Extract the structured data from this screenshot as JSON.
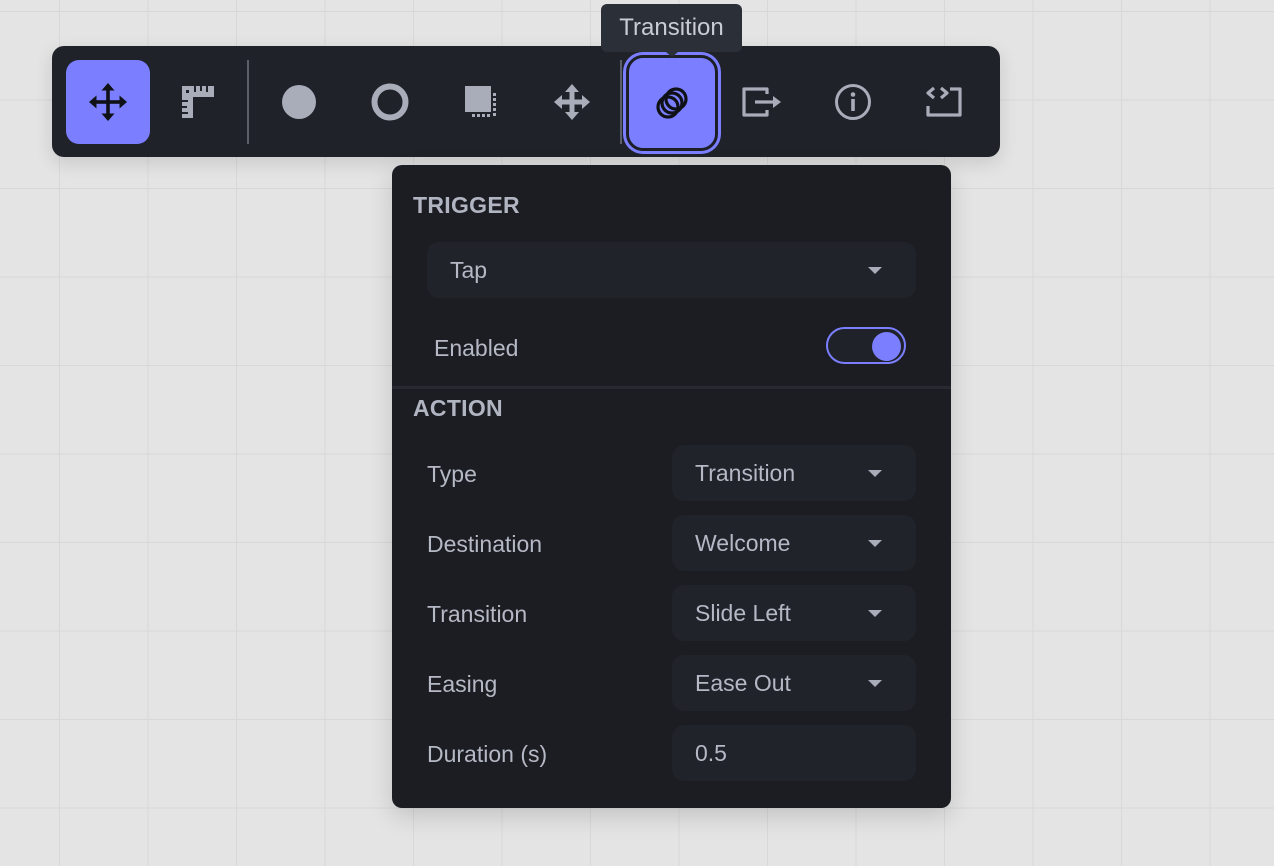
{
  "toolbar": {
    "tools": [
      {
        "id": "move",
        "icon": "move-arrows-icon",
        "state": "active"
      },
      {
        "id": "measure",
        "icon": "ruler-icon",
        "state": "default"
      },
      {
        "id": "circle-fill",
        "icon": "filled-circle-icon",
        "state": "default"
      },
      {
        "id": "circle-outline",
        "icon": "ring-icon",
        "state": "default"
      },
      {
        "id": "shadow-box",
        "icon": "square-shadow-icon",
        "state": "default"
      },
      {
        "id": "pan",
        "icon": "pan-arrows-icon",
        "state": "default"
      },
      {
        "id": "transition",
        "icon": "overlapping-rings-icon",
        "state": "selected"
      },
      {
        "id": "export",
        "icon": "exit-arrow-icon",
        "state": "default"
      },
      {
        "id": "info",
        "icon": "info-icon",
        "state": "default"
      },
      {
        "id": "embed",
        "icon": "code-box-icon",
        "state": "default"
      }
    ],
    "tooltip": "Transition"
  },
  "panel": {
    "trigger": {
      "title": "TRIGGER",
      "event": "Tap",
      "enabled_label": "Enabled",
      "enabled": true
    },
    "action": {
      "title": "ACTION",
      "rows": [
        {
          "label": "Type",
          "value": "Transition",
          "kind": "select"
        },
        {
          "label": "Destination",
          "value": "Welcome",
          "kind": "select"
        },
        {
          "label": "Transition",
          "value": "Slide Left",
          "kind": "select"
        },
        {
          "label": "Easing",
          "value": "Ease Out",
          "kind": "select"
        },
        {
          "label": "Duration (s)",
          "value": "0.5",
          "kind": "input"
        }
      ]
    }
  },
  "colors": {
    "accent": "#7b7fff",
    "toolbar_bg": "#1f2229",
    "panel_bg": "#1b1d22",
    "icon": "#a9adba",
    "canvas": "#e4e4e4"
  }
}
